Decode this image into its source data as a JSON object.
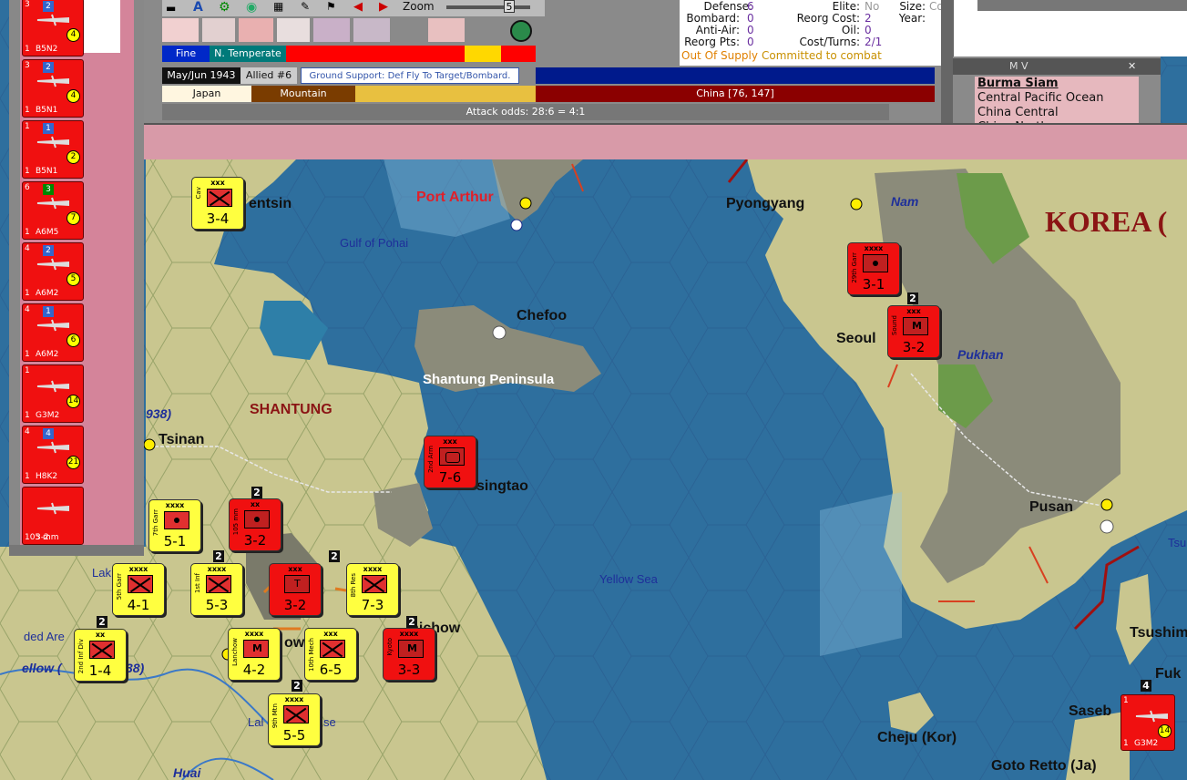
{
  "toolbar": {
    "zoom_label": "Zoom",
    "zoom_value": "5"
  },
  "weather": {
    "weather": "Fine",
    "climate": "N. Temperate",
    "date": "May/Jun 1943",
    "turn": "Allied #6",
    "mission": "Ground Support: Def Fly To Target/Bombard.",
    "attacker_nation": "Japan",
    "terrain": "Mountain",
    "defender": "China [76, 147]",
    "attack_odds": "Attack odds: 28:6 = 4:1"
  },
  "unit_info": {
    "defense_label": "Defense:",
    "defense_value": "6",
    "bombard_label": "Bombard:",
    "bombard_value": "0",
    "antiair_label": "Anti-Air:",
    "antiair_value": "0",
    "reorg_pts_label": "Reorg Pts:",
    "reorg_pts_value": "0",
    "elite_label": "Elite:",
    "elite_value": "No",
    "reorg_cost_label": "Reorg Cost:",
    "reorg_cost_value": "2",
    "oil_label": "Oil:",
    "oil_value": "0",
    "cost_turns_label": "Cost/Turns:",
    "cost_turns_value": "2/1",
    "size_label": "Size:",
    "size_value": "Corps",
    "year_label": "Year:",
    "status_supply": "Out Of Supply",
    "status_combat": "Committed to combat"
  },
  "mv_panel": {
    "title": "M V",
    "items": [
      "Burma Siam",
      "Central Pacific Ocean",
      "China Central",
      "China North"
    ]
  },
  "map": {
    "labels": [
      {
        "text": "Port Arthur",
        "cls": "city-red"
      },
      {
        "text": "Pyongyang",
        "cls": "city"
      },
      {
        "text": "Nam",
        "cls": "water-b"
      },
      {
        "text": "KOREA (",
        "cls": "korea"
      },
      {
        "text": "entsin",
        "cls": "city"
      },
      {
        "text": "Gulf of Pohai",
        "cls": "water"
      },
      {
        "text": "Chefoo",
        "cls": "city"
      },
      {
        "text": "Shantung Peninsula",
        "cls": "whitelabel"
      },
      {
        "text": "Seoul",
        "cls": "city"
      },
      {
        "text": "Pukhan",
        "cls": "water-b"
      },
      {
        "text": "938)",
        "cls": "water-b"
      },
      {
        "text": "SHANTUNG",
        "cls": "region"
      },
      {
        "text": "Tsinan",
        "cls": "city"
      },
      {
        "text": "singtao",
        "cls": "city"
      },
      {
        "text": "Pusan",
        "cls": "city"
      },
      {
        "text": "Tsu",
        "cls": "water"
      },
      {
        "text": "Yellow Sea",
        "cls": "water"
      },
      {
        "text": "Lak",
        "cls": "water"
      },
      {
        "text": "aichow",
        "cls": "city"
      },
      {
        "text": "ded Are",
        "cls": "water"
      },
      {
        "text": "ellow (",
        "cls": "water-b"
      },
      {
        "text": "38)",
        "cls": "water-b"
      },
      {
        "text": "ow",
        "cls": "city"
      },
      {
        "text": "Tsushima",
        "cls": "city"
      },
      {
        "text": "Fuk",
        "cls": "city"
      },
      {
        "text": "Saseb",
        "cls": "city"
      },
      {
        "text": "Lal",
        "cls": "water"
      },
      {
        "text": "se",
        "cls": "water"
      },
      {
        "text": "Cheju (Kor)",
        "cls": "city"
      },
      {
        "text": "Goto Retto (Ja)",
        "cls": "city"
      },
      {
        "text": "Huai",
        "cls": "water-b"
      }
    ],
    "counters": [
      {
        "color": "yel",
        "size": "xxx",
        "side": "Cav",
        "str": "3-4",
        "sym": "x"
      },
      {
        "color": "red",
        "size": "xxxx",
        "side": "29th Garr",
        "str": "3-1",
        "sym": "dot"
      },
      {
        "color": "red",
        "size": "xxx",
        "side": "Sound",
        "str": "3-2",
        "sym": "m"
      },
      {
        "color": "red",
        "size": "xxx",
        "side": "2nd Arm",
        "str": "7-6",
        "sym": "box"
      },
      {
        "color": "yel",
        "size": "xxxx",
        "side": "7th Garr",
        "str": "5-1",
        "sym": "dot"
      },
      {
        "color": "red",
        "size": "xx",
        "side": "105 mm",
        "str": "3-2",
        "sym": "dot"
      },
      {
        "color": "yel",
        "size": "xxxx",
        "side": "5th Garr",
        "str": "4-1",
        "sym": "x"
      },
      {
        "color": "yel",
        "size": "xxxx",
        "side": "1st Inf",
        "str": "5-3",
        "sym": "x"
      },
      {
        "color": "red",
        "size": "xxx",
        "side": "",
        "str": "3-2",
        "sym": "t"
      },
      {
        "color": "yel",
        "size": "xxxx",
        "side": "8th Res",
        "str": "7-3",
        "sym": "x"
      },
      {
        "color": "yel",
        "size": "xx",
        "side": "2nd Inf Div",
        "str": "1-4",
        "sym": "x"
      },
      {
        "color": "yel",
        "size": "xxxx",
        "side": "Lanchow",
        "str": "4-2",
        "sym": "m"
      },
      {
        "color": "yel",
        "size": "xxx",
        "side": "10th Mech",
        "str": "6-5",
        "sym": "x"
      },
      {
        "color": "red",
        "size": "xxxx",
        "side": "Kyoto",
        "str": "3-3",
        "sym": "m"
      },
      {
        "color": "yel",
        "size": "xxxx",
        "side": "9th Mtn",
        "str": "5-5",
        "sym": "x"
      }
    ],
    "stack_numbers": [
      "2",
      "2",
      "2",
      "2",
      "2",
      "2",
      "2",
      "4"
    ],
    "corner_unit": {
      "top": "1",
      "value": "14",
      "name": "G3M2",
      "bottom": "1"
    }
  },
  "air_units": [
    {
      "top": "3",
      "badge": "2",
      "val": "4",
      "name": "B5N2",
      "bottom": "1"
    },
    {
      "top": "3",
      "badge": "2",
      "val": "4",
      "name": "B5N1",
      "bottom": "1"
    },
    {
      "top": "1",
      "badge": "1",
      "val": "2",
      "name": "B5N1",
      "bottom": "1"
    },
    {
      "top": "6",
      "badge": "3",
      "val": "7",
      "name": "A6M5",
      "bottom": "1"
    },
    {
      "top": "4",
      "badge": "2",
      "val": "5",
      "name": "A6M2",
      "bottom": "1"
    },
    {
      "top": "4",
      "badge": "1",
      "val": "6",
      "name": "A6M2",
      "bottom": "1"
    },
    {
      "top": "1",
      "badge": "",
      "val": "14",
      "name": "G3M2",
      "bottom": "1"
    },
    {
      "top": "4",
      "badge": "4",
      "val": "21",
      "name": "H8K2",
      "bottom": "1"
    },
    {
      "top": "",
      "badge": "",
      "val": "",
      "name": "3-2",
      "bottom": "105 mm"
    }
  ],
  "colors": {
    "axis_red": "#f01010",
    "allied_yellow": "#ffff40",
    "sea": "#2e6f9e",
    "china_banner": "#8b0000"
  }
}
